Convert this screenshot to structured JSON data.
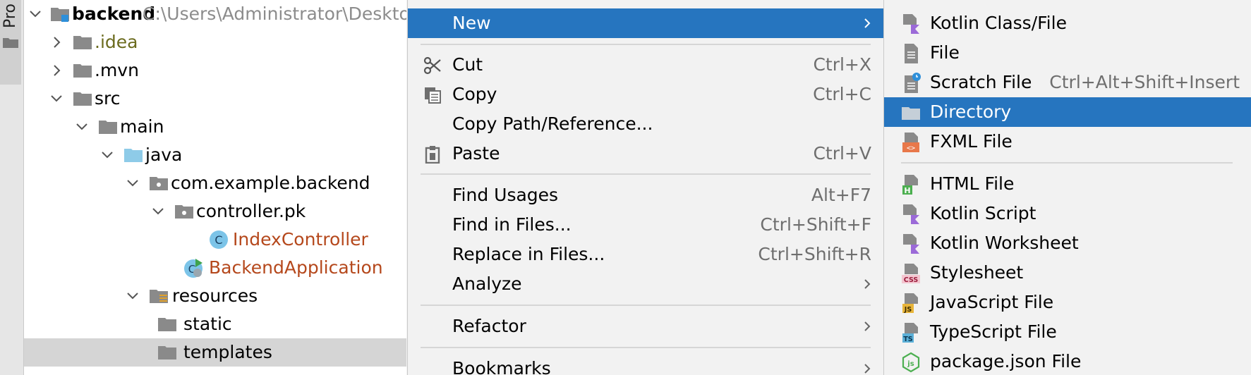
{
  "toolwindow": {
    "tab_label": "Pro"
  },
  "tree": {
    "rows": [
      {
        "label": "backend",
        "path": "C:\\Users\\Administrator\\Desktop\\",
        "icon": "module-folder-icon",
        "chevron": "expanded",
        "bold": true
      },
      {
        "label": ".idea",
        "icon": "folder-icon",
        "chevron": "collapsed",
        "color": "#6b6b1e"
      },
      {
        "label": ".mvn",
        "icon": "folder-icon",
        "chevron": "collapsed"
      },
      {
        "label": "src",
        "icon": "folder-icon",
        "chevron": "expanded"
      },
      {
        "label": "main",
        "icon": "folder-icon",
        "chevron": "expanded"
      },
      {
        "label": "java",
        "icon": "source-folder-icon",
        "chevron": "expanded"
      },
      {
        "label": "com.example.backend",
        "icon": "package-icon",
        "chevron": "expanded"
      },
      {
        "label": "controller.pk",
        "icon": "package-icon",
        "chevron": "expanded"
      },
      {
        "label": "IndexController",
        "icon": "class-icon",
        "chevron": "none",
        "color": "#b5481c"
      },
      {
        "label": "BackendApplication",
        "icon": "spring-boot-class-icon",
        "chevron": "none",
        "color": "#b5481c"
      },
      {
        "label": "resources",
        "icon": "resources-folder-icon",
        "chevron": "expanded"
      },
      {
        "label": "static",
        "icon": "folder-icon",
        "chevron": "none"
      },
      {
        "label": "templates",
        "icon": "folder-icon",
        "chevron": "none",
        "selected": true
      }
    ]
  },
  "menu": {
    "new": {
      "label": "New"
    },
    "cut": {
      "label": "Cut",
      "shortcut": "Ctrl+X"
    },
    "copy": {
      "label": "Copy",
      "shortcut": "Ctrl+C"
    },
    "copy_path": {
      "label": "Copy Path/Reference..."
    },
    "paste": {
      "label": "Paste",
      "shortcut": "Ctrl+V"
    },
    "find_usages": {
      "label": "Find Usages",
      "shortcut": "Alt+F7"
    },
    "find_in_files": {
      "label": "Find in Files...",
      "shortcut": "Ctrl+Shift+F"
    },
    "replace_in_files": {
      "label": "Replace in Files...",
      "shortcut": "Ctrl+Shift+R"
    },
    "analyze": {
      "label": "Analyze"
    },
    "refactor": {
      "label": "Refactor"
    },
    "bookmarks": {
      "label": "Bookmarks"
    }
  },
  "submenu": {
    "kotlin_class": {
      "label": "Kotlin Class/File"
    },
    "file": {
      "label": "File"
    },
    "scratch": {
      "label": "Scratch File",
      "shortcut": "Ctrl+Alt+Shift+Insert"
    },
    "directory": {
      "label": "Directory"
    },
    "fxml": {
      "label": "FXML File"
    },
    "html": {
      "label": "HTML File"
    },
    "kotlin_script": {
      "label": "Kotlin Script"
    },
    "kotlin_worksheet": {
      "label": "Kotlin Worksheet"
    },
    "stylesheet": {
      "label": "Stylesheet"
    },
    "javascript": {
      "label": "JavaScript File"
    },
    "typescript": {
      "label": "TypeScript File"
    },
    "package_json": {
      "label": "package.json File"
    }
  },
  "colors": {
    "accent": "#2675bf",
    "selection_gray": "#d5d5d5",
    "class_name": "#b5481c",
    "idea_folder": "#6b6b1e"
  }
}
